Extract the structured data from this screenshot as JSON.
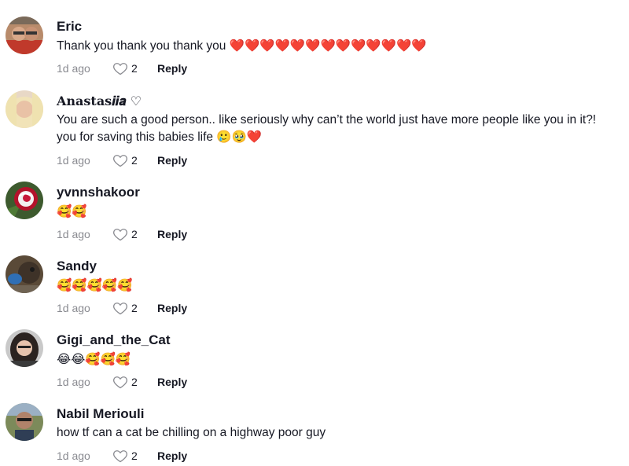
{
  "top_cut_text": "· · · ·",
  "comments": [
    {
      "user": "Eric",
      "text": "Thank you thank you thank you ❤️❤️❤️❤️❤️❤️❤️❤️❤️❤️❤️❤️❤️",
      "time": "1d ago",
      "likes": "2",
      "reply": "Reply"
    },
    {
      "user": "𝐀𝐧𝐚𝐬𝐭𝐚𝐬𝒊𝒊𝒂 ♡",
      "text": "You are such a good person.. like seriously why can’t the world just have more people like you in it?!",
      "text2": "you for saving this babies life 🥲🥹❤️",
      "time": "1d ago",
      "likes": "2",
      "reply": "Reply"
    },
    {
      "user": "yvnnshakoor",
      "text": "🥰🥰",
      "time": "1d ago",
      "likes": "2",
      "reply": "Reply"
    },
    {
      "user": "Sandy",
      "text": "🥰🥰🥰🥰🥰",
      "time": "1d ago",
      "likes": "2",
      "reply": "Reply"
    },
    {
      "user": "Gigi_and_the_Cat",
      "text": "😂😂🥰🥰🥰",
      "time": "1d ago",
      "likes": "2",
      "reply": "Reply"
    },
    {
      "user": "Nabil Meriouli",
      "text": "how tf can a cat be chilling on a highway poor guy",
      "time": "1d ago",
      "likes": "2",
      "reply": "Reply"
    }
  ],
  "colors": {
    "text": "#161823",
    "muted": "#8a8b91",
    "background": "#ffffff"
  },
  "icons": {
    "like": "heart-outline-icon"
  }
}
